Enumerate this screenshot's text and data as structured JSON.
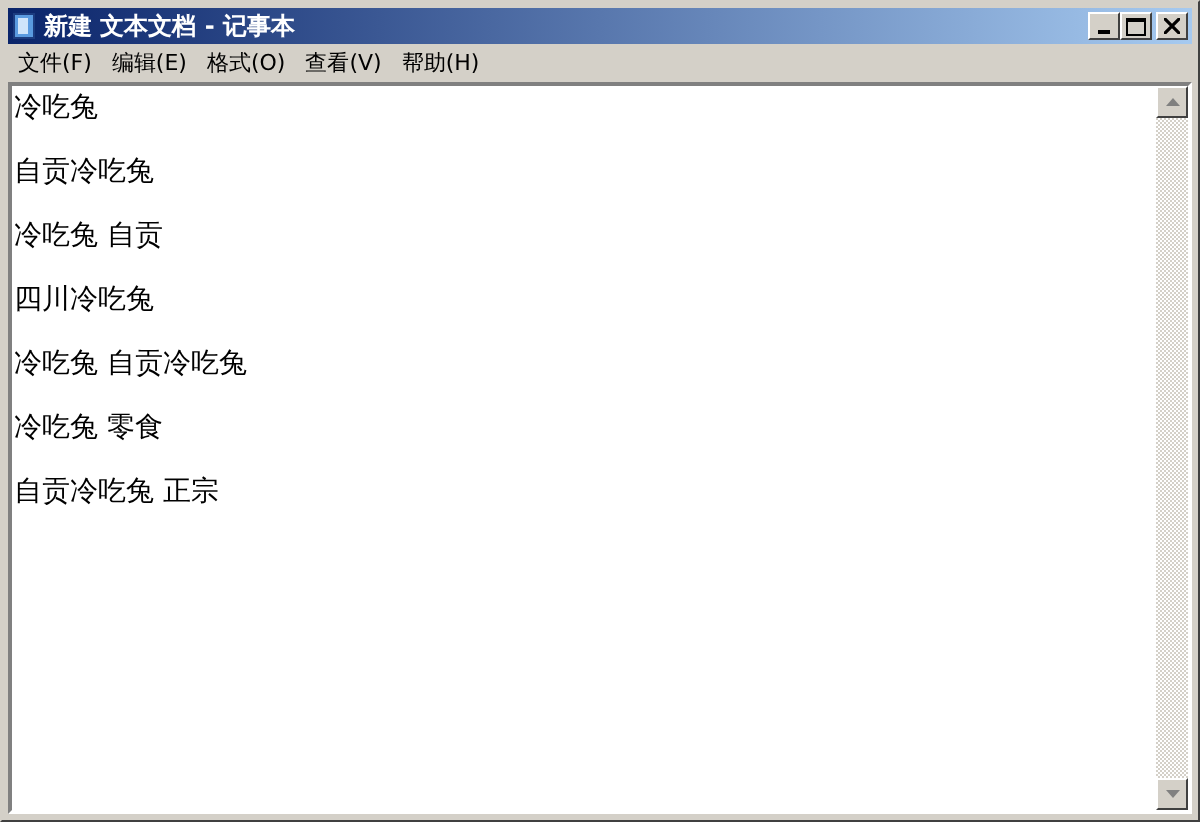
{
  "window": {
    "title": "新建 文本文档 - 记事本"
  },
  "menu": [
    "文件(F)",
    "编辑(E)",
    "格式(O)",
    "查看(V)",
    "帮助(H)"
  ],
  "lines": [
    "冷吃兔",
    "自贡冷吃兔",
    "冷吃兔 自贡",
    "四川冷吃兔",
    "冷吃兔 自贡冷吃兔",
    "冷吃兔 零食",
    "自贡冷吃兔 正宗"
  ]
}
